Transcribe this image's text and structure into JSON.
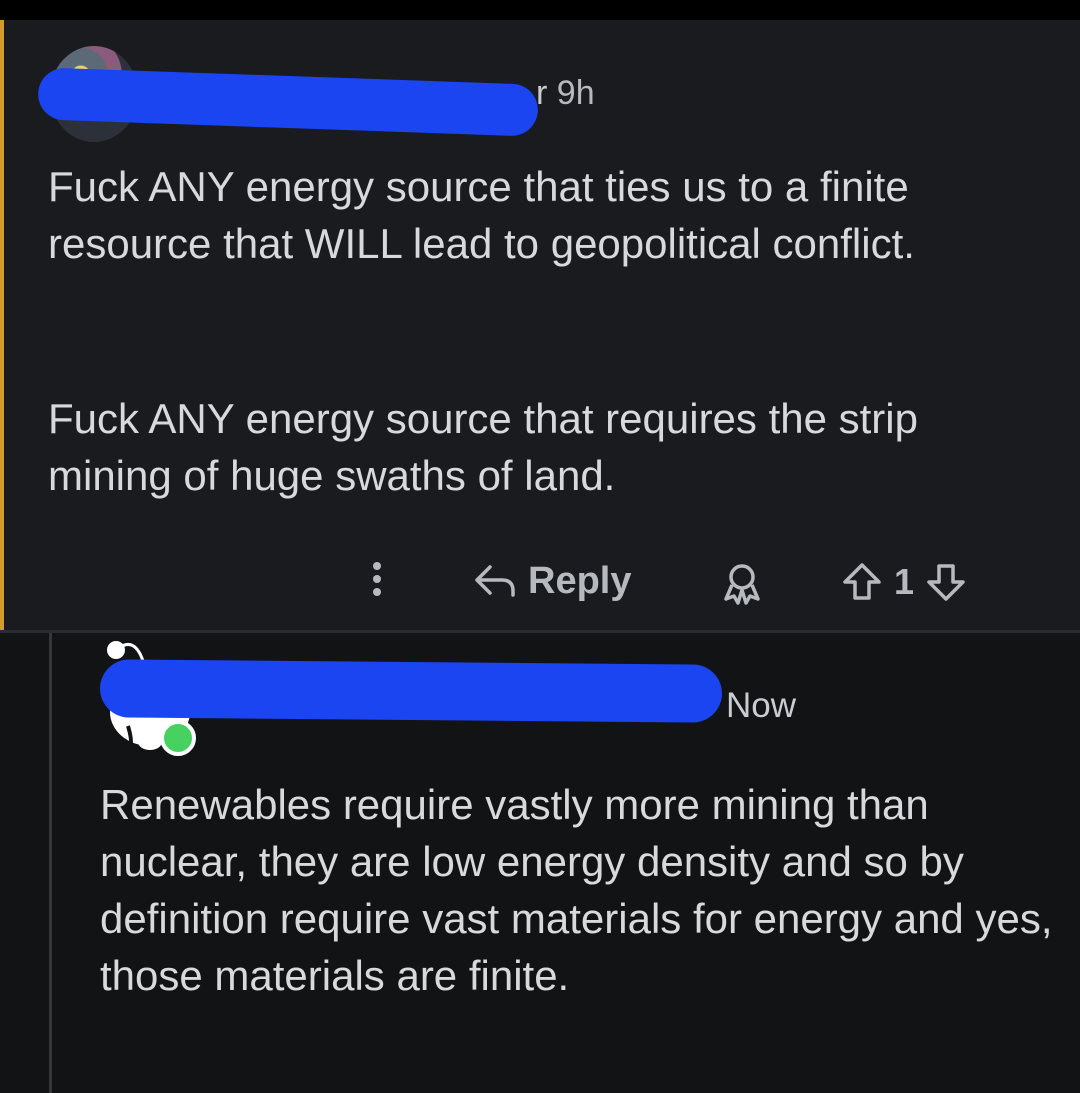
{
  "comment": {
    "username_partial": "r",
    "age": "9h",
    "paragraphs": [
      "Fuck ANY energy source that ties us to a finite resource that WILL lead to geopolitical conflict.",
      "Fuck ANY energy source that requires the strip mining of huge swaths of land."
    ],
    "actions": {
      "reply_label": "Reply",
      "vote_count": "1"
    }
  },
  "reply": {
    "age": "Now",
    "text": "Renewables require vastly more mining than nuclear, they are low energy density and so by definition require vast materials for energy and yes, those materials are finite."
  },
  "colors": {
    "highlight": "#d39b2b",
    "redaction": "#1a45f0",
    "online": "#46d160"
  }
}
